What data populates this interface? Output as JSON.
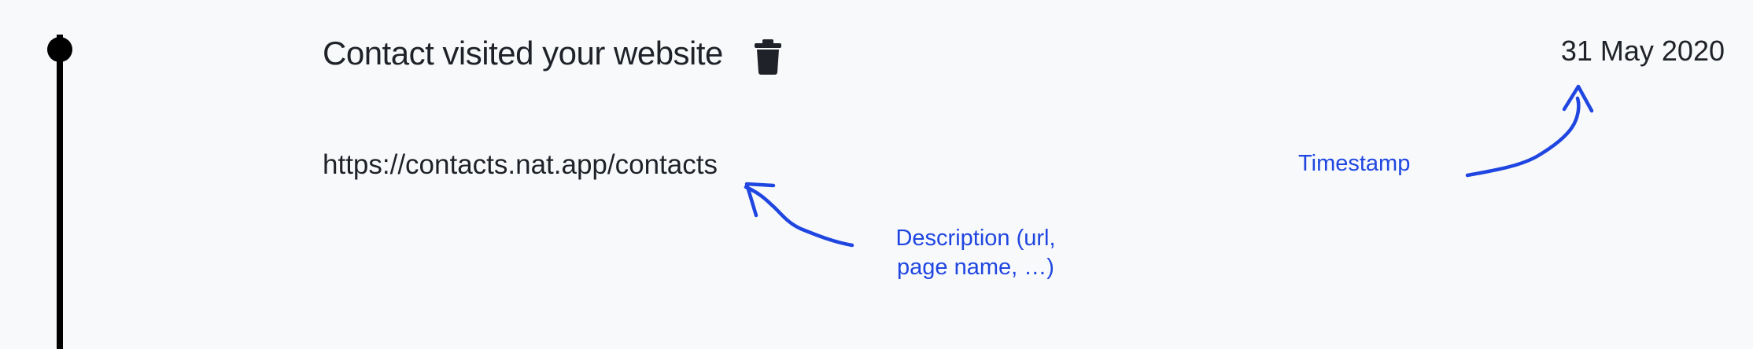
{
  "event": {
    "title": "Contact visited your website",
    "date": "31 May 2020",
    "description": "https://contacts.nat.app/contacts",
    "delete_icon": "trash-icon"
  },
  "annotations": {
    "timestamp": "Timestamp",
    "description_line1": "Description (url,",
    "description_line2": "page name, …)"
  },
  "colors": {
    "annotation": "#1f46e0",
    "text": "#1f2329",
    "timeline": "#000000",
    "background": "#f8f9fb"
  }
}
